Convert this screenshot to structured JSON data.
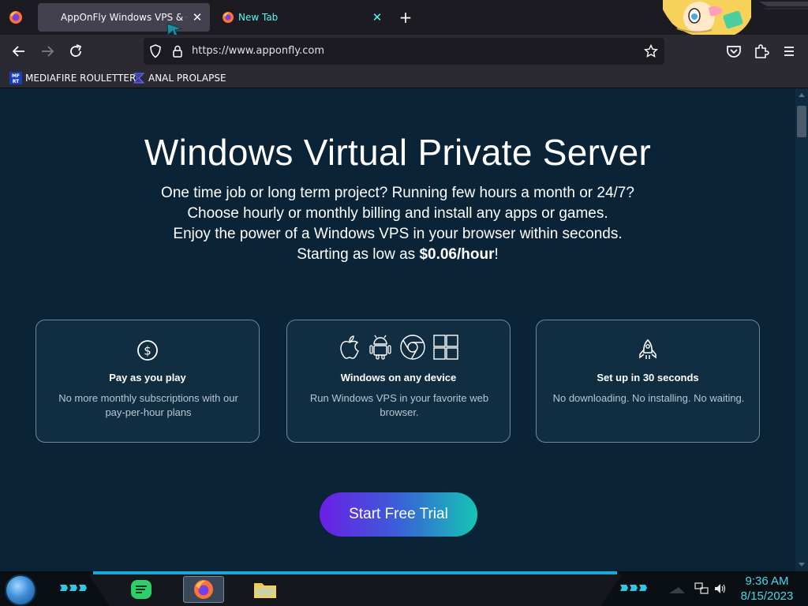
{
  "browser": {
    "tabs": [
      {
        "title": "AppOnFly Windows VPS & Clo",
        "active": true
      },
      {
        "title": "New Tab",
        "active": false
      }
    ],
    "url": "https://www.apponfly.com",
    "bookmarks": [
      {
        "label": "MEDIAFIRE ROULETTER",
        "icon_text": "MFRT"
      },
      {
        "label": "ANAL PROLAPSE"
      }
    ],
    "icons": {
      "back": "back-arrow-icon",
      "forward": "forward-arrow-icon",
      "reload": "reload-icon",
      "shield": "tracking-protection-shield-icon",
      "lock": "lock-icon",
      "bookmark_star": "bookmark-star-icon",
      "pocket": "pocket-icon",
      "extensions": "extensions-puzzle-icon",
      "menu": "hamburger-menu-icon",
      "new_tab": "plus-icon"
    }
  },
  "page": {
    "title": "Windows Virtual Private Server",
    "lines": [
      "One time job or long term project? Running few hours a month or 24/7?",
      "Choose hourly or monthly billing and install any apps or games.",
      "Enjoy the power of a Windows VPS in your browser within seconds."
    ],
    "price_prefix": "Starting as low as ",
    "price": "$0.06/hour",
    "price_suffix": "!",
    "cards": [
      {
        "title": "Pay as you play",
        "desc": "No more monthly subscriptions with our pay-per-hour plans",
        "icon": "dollar-coin-icon"
      },
      {
        "title": "Windows on any device",
        "desc": "Run Windows VPS in your favorite web browser.",
        "icon": "platforms-icons"
      },
      {
        "title": "Set up in 30 seconds",
        "desc": "No downloading. No installing. No waiting.",
        "icon": "rocket-icon"
      }
    ],
    "cta": "Start Free Trial"
  },
  "taskbar": {
    "time": "9:36 AM",
    "date": "8/15/2023",
    "apps": [
      "notes-app-icon",
      "firefox-icon",
      "file-explorer-icon"
    ]
  },
  "colors": {
    "page_bg": "#0a2337",
    "card_border": "#6f8898",
    "cta_start": "#6c1fe6",
    "cta_end": "#14c6b4",
    "clock": "#4fd6e6",
    "new_tab_text": "#5ff5ee"
  }
}
